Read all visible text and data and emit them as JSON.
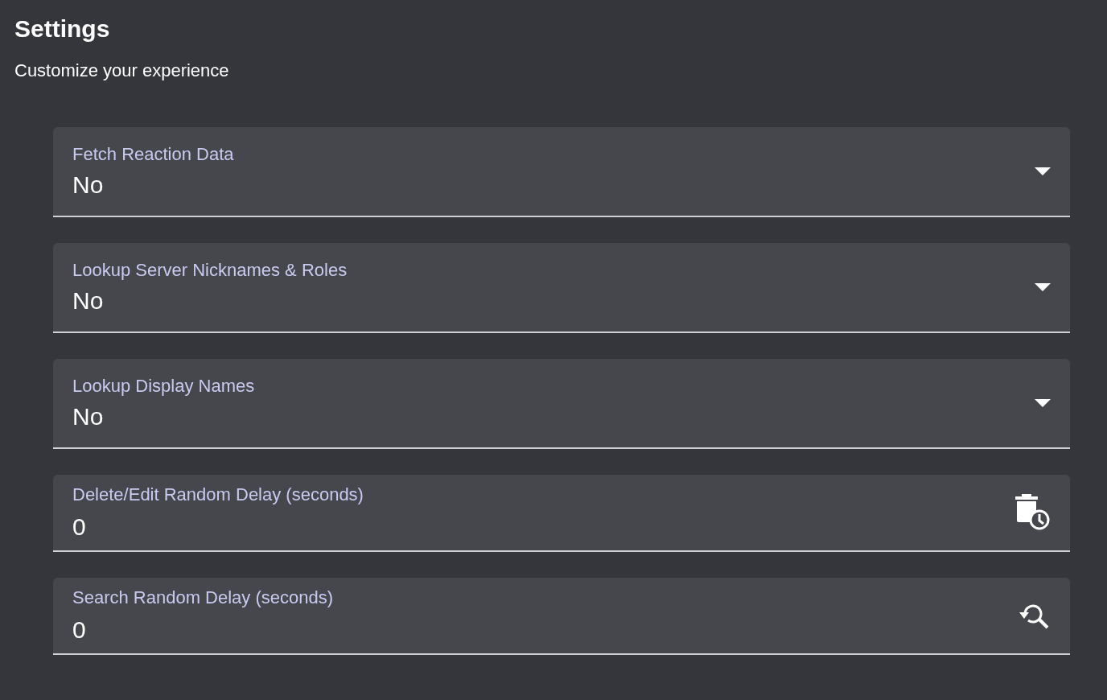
{
  "header": {
    "title": "Settings",
    "subtitle": "Customize your experience"
  },
  "fields": [
    {
      "kind": "dropdown",
      "label": "Fetch Reaction Data",
      "value": "No"
    },
    {
      "kind": "dropdown",
      "label": "Lookup Server Nicknames & Roles",
      "value": "No"
    },
    {
      "kind": "dropdown",
      "label": "Lookup Display Names",
      "value": "No"
    },
    {
      "kind": "delete",
      "label": "Delete/Edit Random Delay (seconds)",
      "value": "0"
    },
    {
      "kind": "search",
      "label": "Search Random Delay (seconds)",
      "value": "0"
    }
  ]
}
